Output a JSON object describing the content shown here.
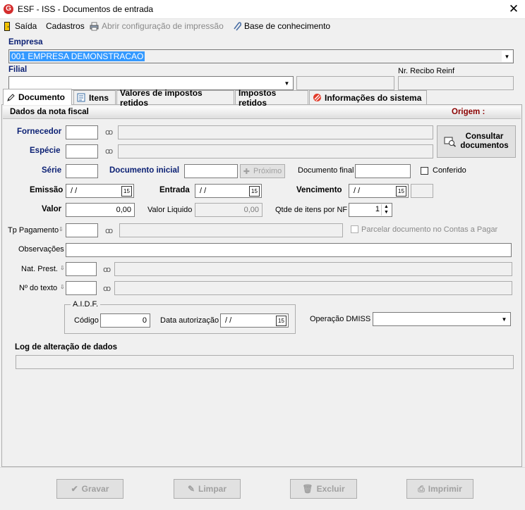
{
  "window": {
    "title": "ESF - ISS - Documentos de entrada",
    "app_icon": "G"
  },
  "menu": {
    "saida": "Saída",
    "cadastros": "Cadastros",
    "abrir_config": "Abrir configuração de impressão",
    "base_conhecimento": "Base de conhecimento"
  },
  "empresa": {
    "label": "Empresa",
    "value": "001 EMPRESA DEMONSTRACAO"
  },
  "filial": {
    "label": "Filial",
    "value": ""
  },
  "recibo": {
    "label": "Nr. Recibo Reinf",
    "value": ""
  },
  "tabs": [
    "Documento",
    "Itens",
    "Valores de impostos retidos",
    "Impostos retidos",
    "Informações do sistema"
  ],
  "section": {
    "title": "Dados da nota fiscal",
    "origem": "Origem :"
  },
  "form": {
    "fornecedor": "Fornecedor",
    "especie": "Espécie",
    "serie": "Série",
    "documento_inicial": "Documento inicial",
    "proximo": "Próximo",
    "documento_final": "Documento final",
    "conferido": "Conferido",
    "emissao": "Emissão",
    "emissao_value": "/ /",
    "entrada": "Entrada",
    "entrada_value": "/ /",
    "vencimento": "Vencimento",
    "vencimento_value": "/ /",
    "valor": "Valor",
    "valor_value": "0,00",
    "valor_liquido": "Valor Liquido",
    "valor_liquido_value": "0,00",
    "qtde_itens": "Qtde de itens por NF",
    "qtde_value": "1",
    "tp_pagamento": "Tp Pagamento",
    "parcelar": "Parcelar documento no Contas a Pagar",
    "observacoes": "Observações",
    "nat_prest": "Nat. Prest.",
    "no_texto": "Nº do texto",
    "consultar": "Consultar documentos",
    "calendar_glyph": "15"
  },
  "aidf": {
    "legend": "A.I.D.F.",
    "codigo": "Código",
    "codigo_value": "0",
    "data_autorizacao": "Data autorização",
    "data_value": "/ /"
  },
  "operacao_dmiss": "Operação DMISS",
  "log": {
    "label": "Log de alteração de dados"
  },
  "buttons": {
    "gravar": "Gravar",
    "limpar": "Limpar",
    "excluir": "Excluir",
    "imprimir": "Imprimir"
  },
  "colors": {
    "label_blue": "#0a1f73",
    "origem_red": "#8b0000",
    "selection": "#3399ff"
  }
}
